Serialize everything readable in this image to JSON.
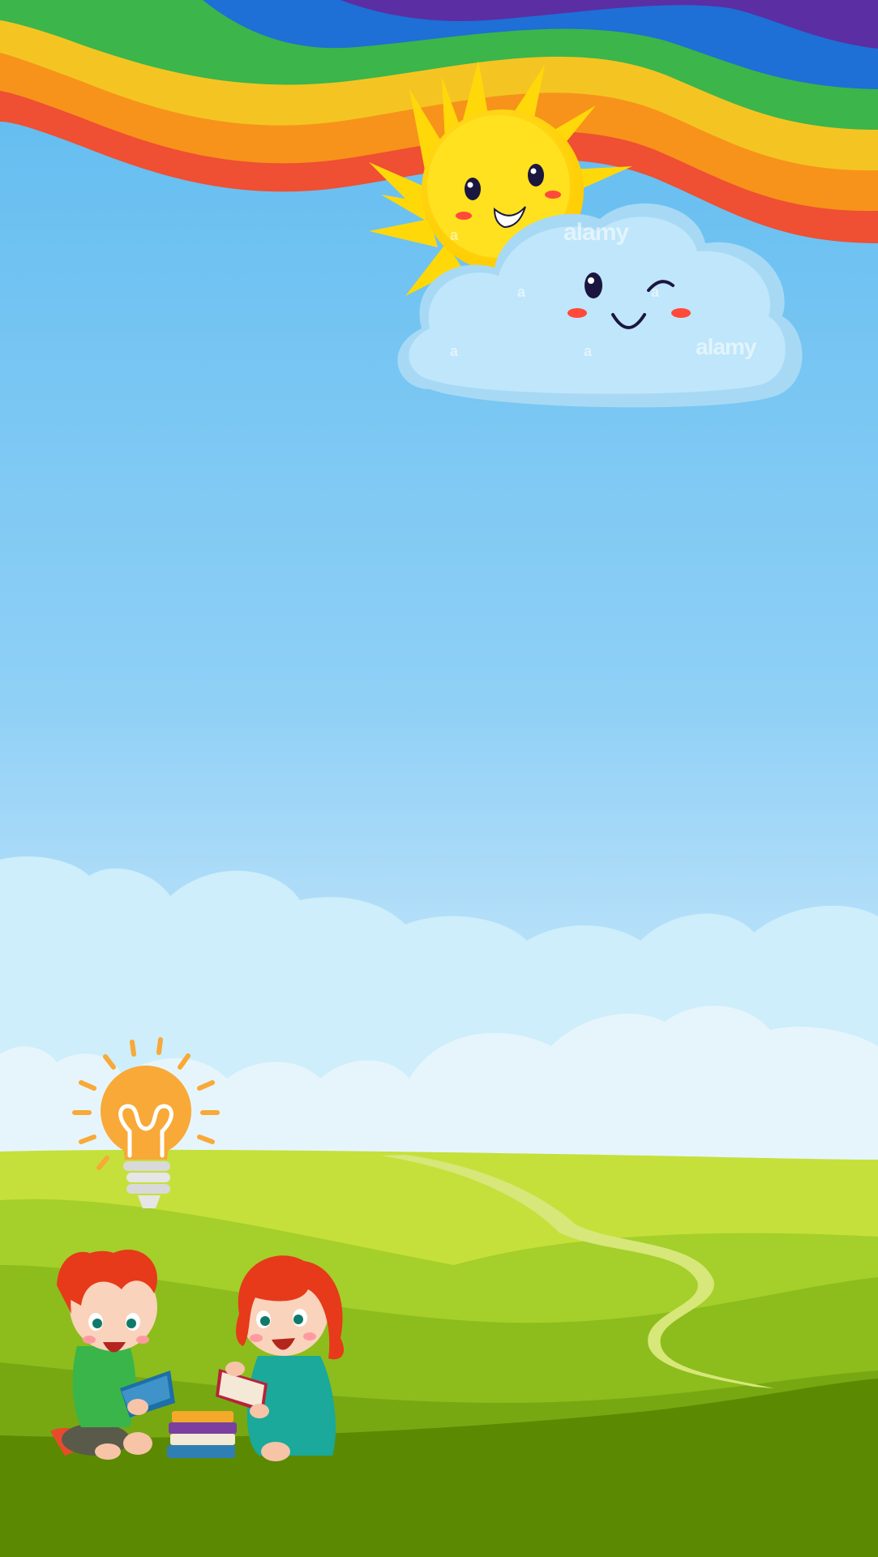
{
  "scene": {
    "description_free": true,
    "colors": {
      "sky_top": "#62bdf0",
      "sky_bottom": "#eaf6fd",
      "grass_light": "#c5e03a",
      "grass_mid": "#8cbd1c",
      "grass_dark": "#5b8a02",
      "path": "#d7e77a",
      "sun": "#ffd80a",
      "cloud": "#bfe6fb",
      "bulb": "#f8a937"
    },
    "rainbow_colors": [
      "#ef4f33",
      "#f7931a",
      "#f4c522",
      "#3cb54a",
      "#1e6fd6",
      "#5b2ea3"
    ],
    "watermarks": [
      "alamy",
      "alamy",
      "a",
      "a",
      "a",
      "a",
      "a"
    ]
  }
}
